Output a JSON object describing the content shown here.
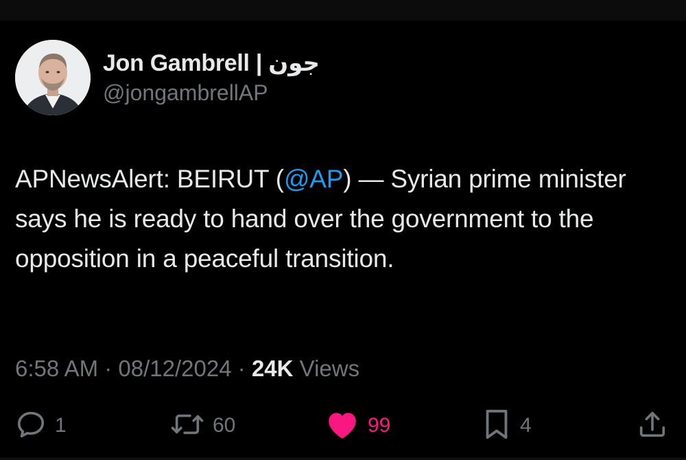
{
  "author": {
    "display_name": "Jon Gambrell | جون",
    "handle": "@jongambrellAP"
  },
  "tweet": {
    "prefix": "APNewsAlert: BEIRUT (",
    "mention": "@AP",
    "suffix": ") — Syrian prime minister says he is ready to hand over the government to the opposition in a peaceful transition."
  },
  "meta": {
    "time": "6:58 AM",
    "separator": "·",
    "date": "08/12/2024",
    "views_count": "24K",
    "views_label": "Views"
  },
  "actions": {
    "replies": "1",
    "reposts": "60",
    "likes": "99",
    "bookmarks": "4"
  },
  "colors": {
    "background": "#000000",
    "text": "#e7e9ea",
    "secondary": "#71767b",
    "link": "#1d9bf0",
    "like": "#f91880"
  },
  "icons": [
    "reply-icon",
    "repost-icon",
    "like-icon",
    "bookmark-icon",
    "share-icon"
  ]
}
